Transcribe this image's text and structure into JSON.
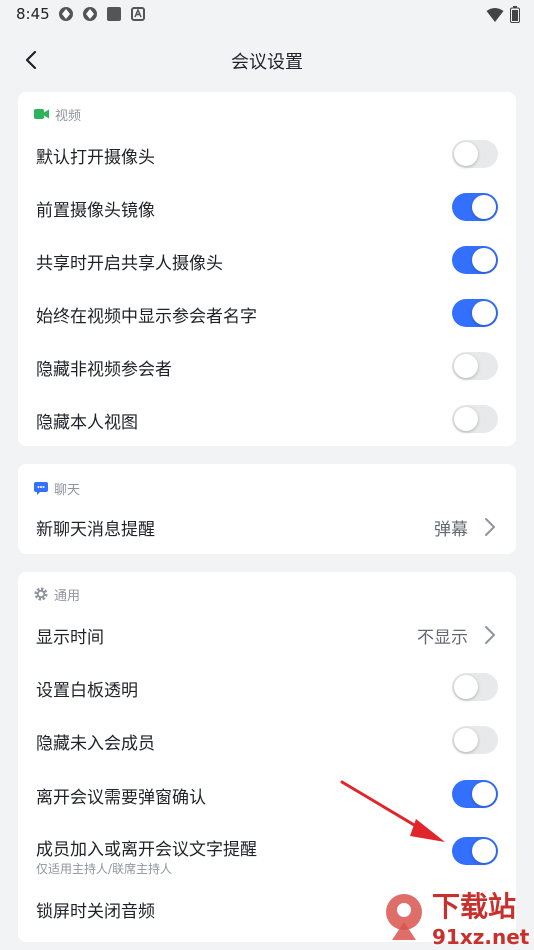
{
  "status": {
    "time": "8:45"
  },
  "nav": {
    "title": "会议设置"
  },
  "video": {
    "title": "视频",
    "items": [
      {
        "label": "默认打开摄像头",
        "on": false
      },
      {
        "label": "前置摄像头镜像",
        "on": true
      },
      {
        "label": "共享时开启共享人摄像头",
        "on": true
      },
      {
        "label": "始终在视频中显示参会者名字",
        "on": true
      },
      {
        "label": "隐藏非视频参会者",
        "on": false
      },
      {
        "label": "隐藏本人视图",
        "on": false
      }
    ]
  },
  "chat": {
    "title": "聊天",
    "items": [
      {
        "label": "新聊天消息提醒",
        "value": "弹幕"
      }
    ]
  },
  "general": {
    "title": "通用",
    "items": [
      {
        "label": "显示时间",
        "value": "不显示"
      },
      {
        "label": "设置白板透明",
        "on": false
      },
      {
        "label": "隐藏未入会成员",
        "on": false
      },
      {
        "label": "离开会议需要弹窗确认",
        "on": true
      },
      {
        "label": "成员加入或离开会议文字提醒",
        "sub": "仅适用主持人/联席主持人",
        "on": true
      },
      {
        "label": "锁屏时关闭音频"
      }
    ]
  },
  "watermark": {
    "text1": "下载站",
    "text2": "91xz.net"
  },
  "colors": {
    "accent": "#3370ff",
    "video_icon": "#2cb45d",
    "chat_icon": "#3370ff",
    "arrow": "#e0262a"
  }
}
